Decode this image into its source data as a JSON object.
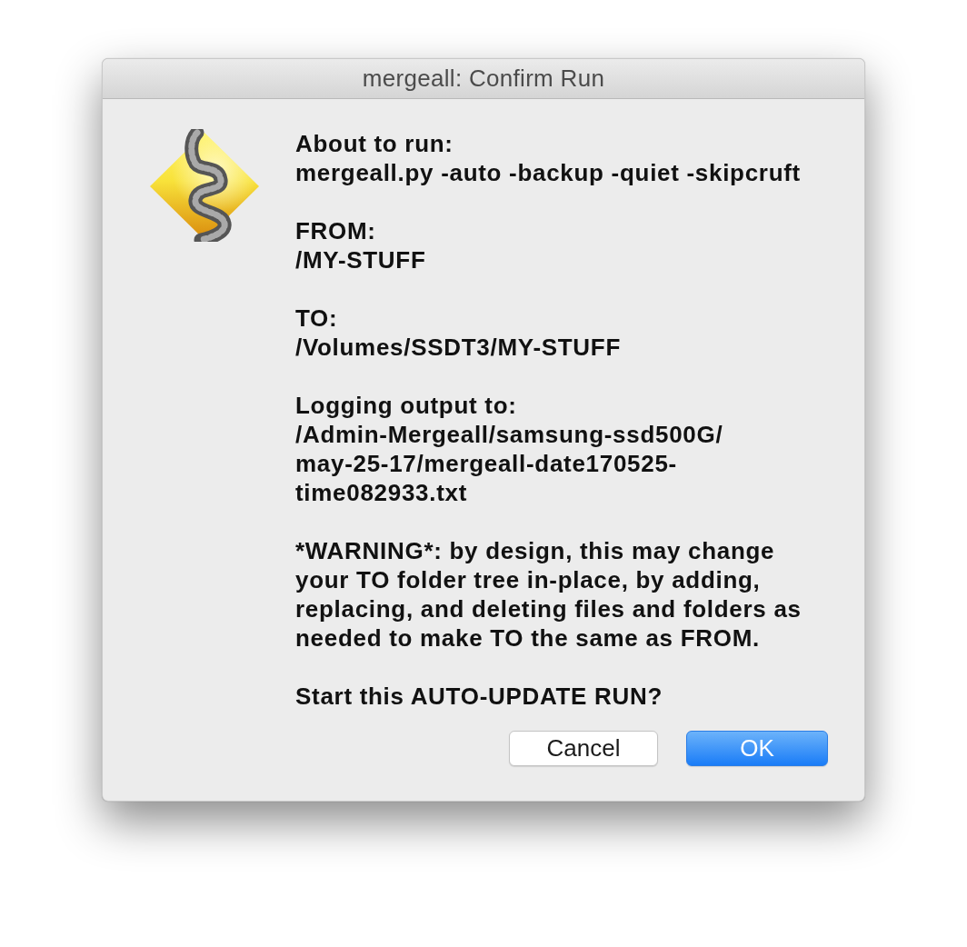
{
  "window": {
    "title": "mergeall: Confirm Run"
  },
  "message": {
    "paragraphs": [
      "About to run:\nmergeall.py -auto -backup -quiet -skipcruft",
      "FROM:\n/MY-STUFF",
      "TO:\n/Volumes/SSDT3/MY-STUFF",
      "Logging output to:\n/Admin-Mergeall/samsung-ssd500G/\nmay-25-17/mergeall-date170525-\ntime082933.txt",
      "*WARNING*: by design, this may change\nyour TO folder tree in-place, by adding,\nreplacing, and deleting files and folders as\nneeded to make TO the same as FROM.",
      "Start this AUTO-UPDATE RUN?"
    ]
  },
  "buttons": [
    {
      "label": "Cancel",
      "default": false
    },
    {
      "label": "OK",
      "default": true
    }
  ]
}
